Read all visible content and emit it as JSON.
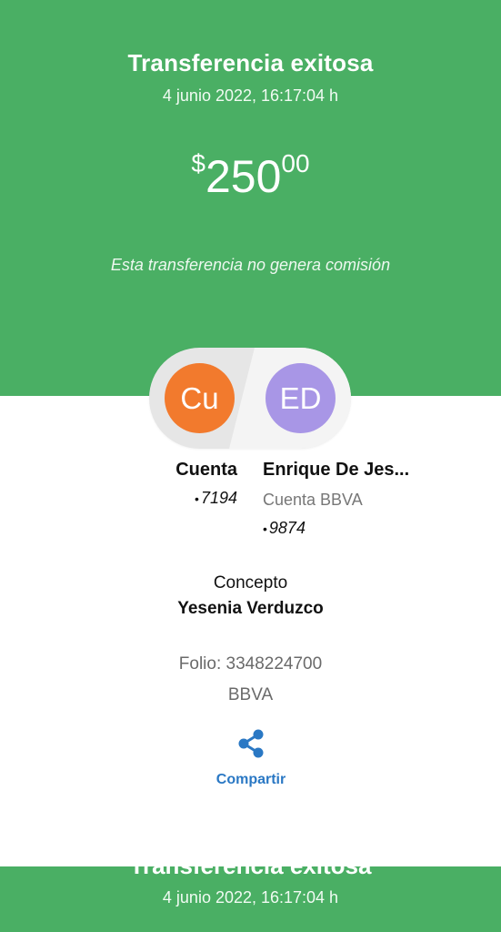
{
  "header": {
    "title": "Transferencia exitosa",
    "date": "4 junio 2022, 16:17:04 h"
  },
  "amount": {
    "currency": "$",
    "integer": "250",
    "decimals": "00"
  },
  "note": "Esta transferencia no genera comisión",
  "from": {
    "avatar_initials": "Cu",
    "name": "Cuenta",
    "account": "7194"
  },
  "to": {
    "avatar_initials": "ED",
    "name": "Enrique De Jes...",
    "bank_label": "Cuenta BBVA",
    "account": "9874"
  },
  "concept": {
    "label": "Concepto",
    "value": "Yesenia Verduzco"
  },
  "folio": "Folio: 3348224700",
  "bank": "BBVA",
  "share": {
    "label": "Compartir",
    "icon": "share-icon"
  },
  "footer": {
    "title": "Transferencia exitosa",
    "date": "4 junio 2022, 16:17:04 h"
  },
  "colors": {
    "brand_green": "#4aaf64",
    "from_avatar": "#f27a2d",
    "to_avatar": "#a896e6",
    "link_blue": "#2a78c4"
  }
}
